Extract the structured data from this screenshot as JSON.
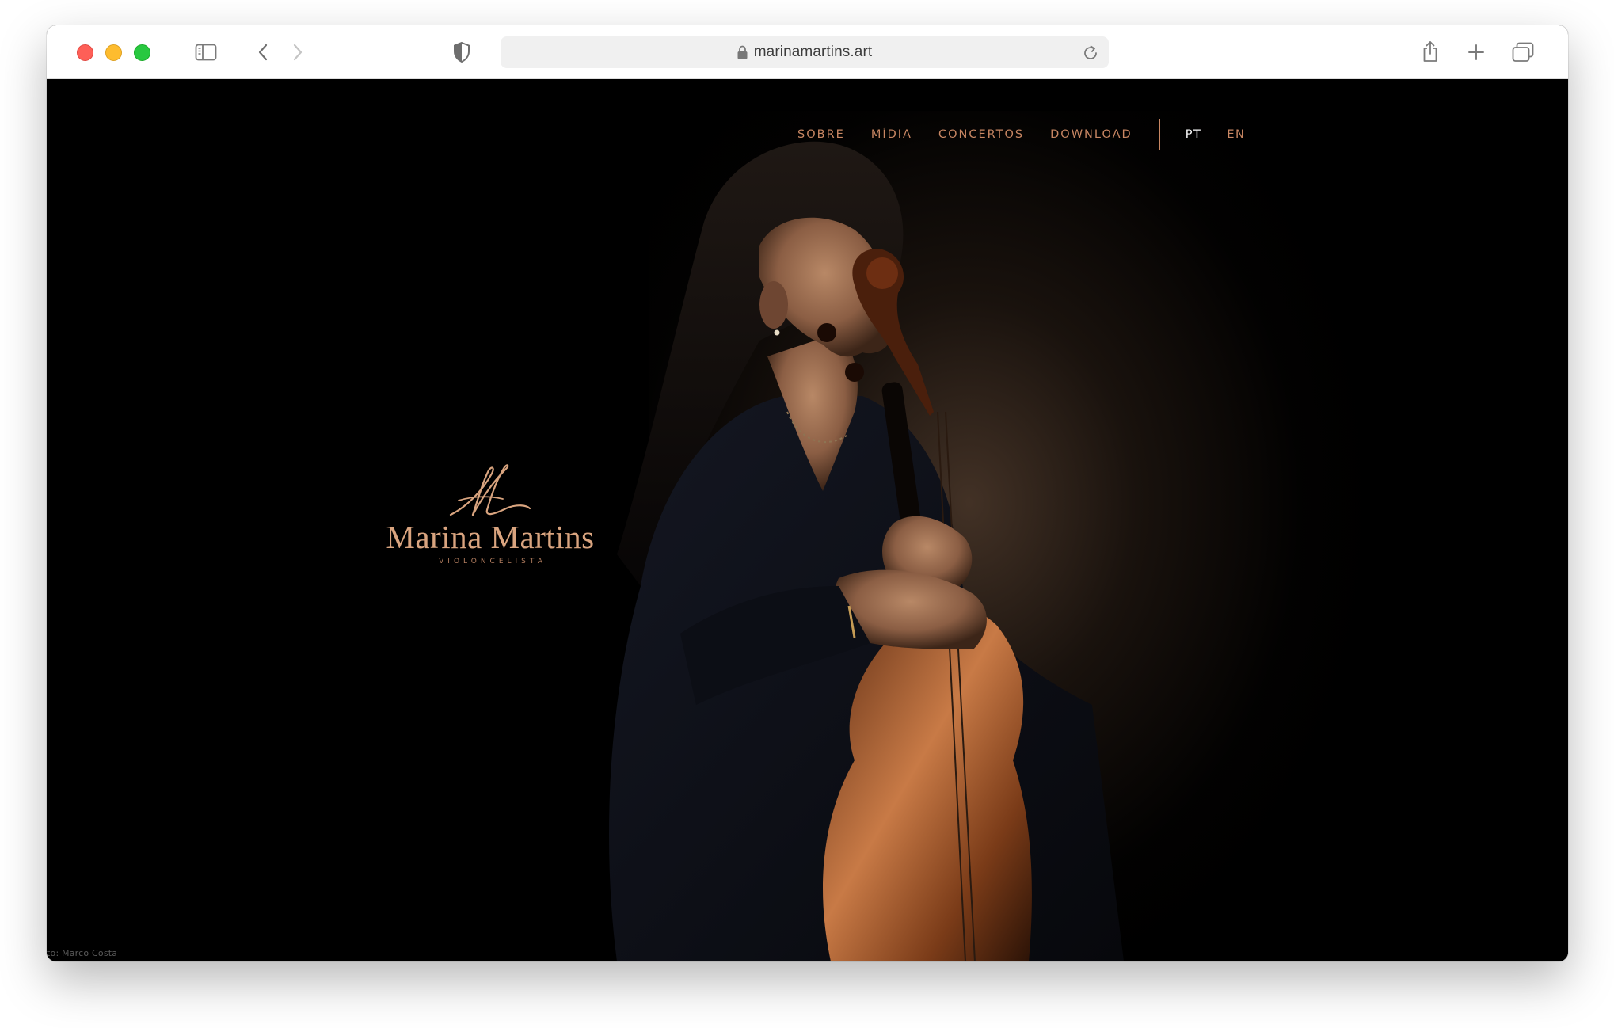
{
  "browser": {
    "url": "marinamartins.art"
  },
  "nav": {
    "items": [
      {
        "label": "SOBRE"
      },
      {
        "label": "MÍDIA"
      },
      {
        "label": "CONCERTOS"
      },
      {
        "label": "DOWNLOAD"
      }
    ],
    "languages": [
      {
        "label": "PT",
        "active": true
      },
      {
        "label": "EN",
        "active": false
      }
    ]
  },
  "logo": {
    "name": "Marina Martins",
    "subtitle": "VIOLONCELISTA"
  },
  "photo": {
    "credit": "to: Marco Costa"
  },
  "colors": {
    "accent": "#c98763",
    "logo": "#d9a47f",
    "background": "#000000"
  }
}
